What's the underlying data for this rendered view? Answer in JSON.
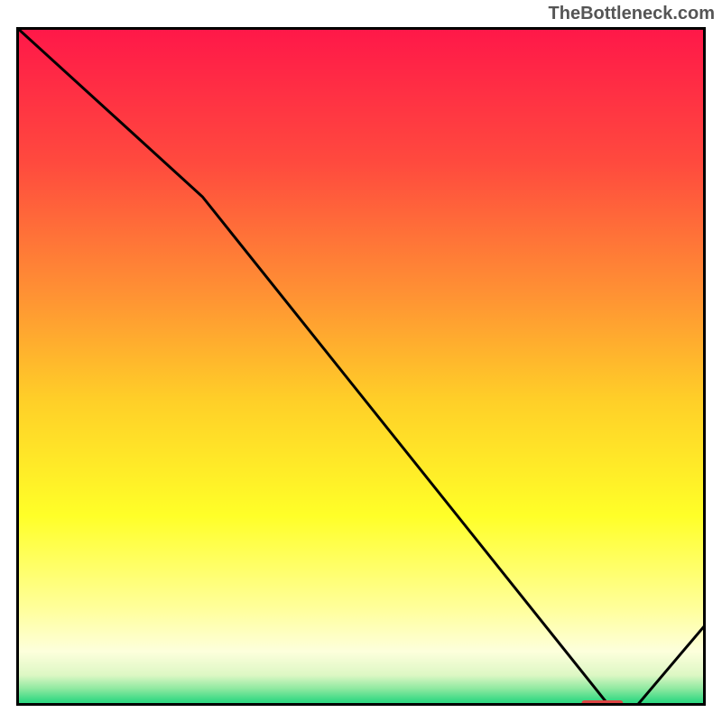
{
  "attribution": "TheBottleneck.com",
  "chart_data": {
    "type": "line",
    "title": "",
    "xlabel": "",
    "ylabel": "",
    "xlim": [
      0,
      100
    ],
    "ylim": [
      0,
      100
    ],
    "x": [
      0,
      27,
      86,
      90,
      100
    ],
    "values": [
      100,
      75,
      0,
      0,
      12
    ],
    "marker_segment": {
      "x0": 82,
      "x1": 88,
      "y": 0
    },
    "colors": {
      "line": "#000000",
      "marker": "#dd4444",
      "border": "#000000"
    },
    "background_gradient": [
      {
        "offset": 0.0,
        "color": "#ff1749"
      },
      {
        "offset": 0.2,
        "color": "#ff4a3e"
      },
      {
        "offset": 0.4,
        "color": "#ff9433"
      },
      {
        "offset": 0.55,
        "color": "#ffcf28"
      },
      {
        "offset": 0.72,
        "color": "#ffff28"
      },
      {
        "offset": 0.86,
        "color": "#ffff9e"
      },
      {
        "offset": 0.92,
        "color": "#fdffdc"
      },
      {
        "offset": 0.955,
        "color": "#ddf7c4"
      },
      {
        "offset": 0.975,
        "color": "#8ee9a0"
      },
      {
        "offset": 0.99,
        "color": "#42db88"
      },
      {
        "offset": 1.0,
        "color": "#1fd67c"
      }
    ]
  }
}
